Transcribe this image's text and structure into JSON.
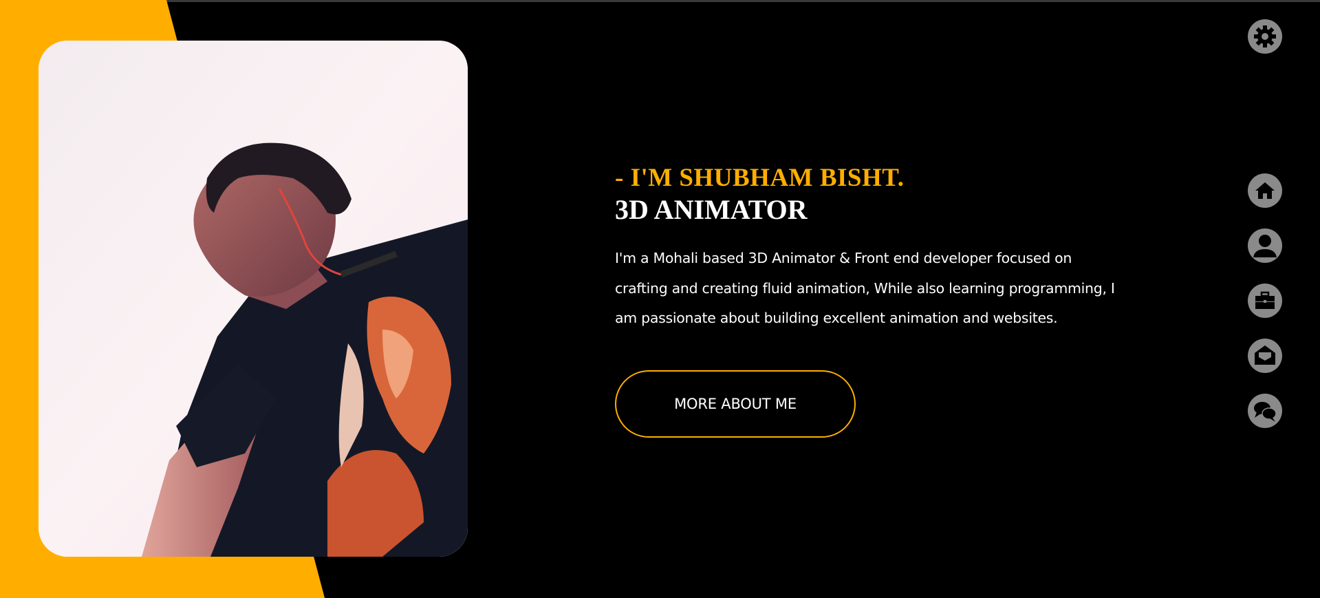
{
  "colors": {
    "accent": "#ffae00",
    "background": "#000000",
    "icon_bg": "#8a8a8a",
    "text": "#ffffff"
  },
  "intro": {
    "name": "- I'M SHUBHAM BISHT.",
    "role": "3D ANIMATOR",
    "description": "I'm a Mohali based 3D Animator & Front end developer focused on crafting and creating fluid animation, While also learning programming, I am passionate about building excellent animation and websites."
  },
  "cta": {
    "label": "MORE ABOUT ME"
  },
  "settings": {
    "icon": "gear-icon"
  },
  "nav": {
    "items": [
      {
        "name": "home",
        "icon": "home-icon"
      },
      {
        "name": "about",
        "icon": "user-icon"
      },
      {
        "name": "portfolio",
        "icon": "briefcase-icon"
      },
      {
        "name": "contact",
        "icon": "envelope-open-icon"
      },
      {
        "name": "blog",
        "icon": "chat-icon"
      }
    ]
  }
}
